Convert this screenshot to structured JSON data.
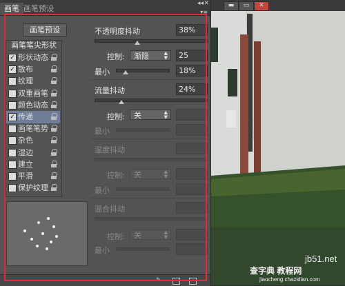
{
  "tabs": {
    "active": "画笔",
    "inactive": "画笔预设"
  },
  "window_controls": {
    "collapse": "◂◂",
    "close": "✕",
    "menu": "▾≡"
  },
  "preset_button": "画笔预设",
  "list_header": "画笔笔尖形状",
  "options": [
    {
      "label": "形状动态",
      "checked": true,
      "selected": false
    },
    {
      "label": "散布",
      "checked": true,
      "selected": false
    },
    {
      "label": "纹理",
      "checked": false,
      "selected": false
    },
    {
      "label": "双重画笔",
      "checked": false,
      "selected": false
    },
    {
      "label": "颜色动态",
      "checked": false,
      "selected": false
    },
    {
      "label": "传递",
      "checked": true,
      "selected": true
    },
    {
      "label": "画笔笔势",
      "checked": false,
      "selected": false
    },
    {
      "label": "杂色",
      "checked": false,
      "selected": false
    },
    {
      "label": "湿边",
      "checked": false,
      "selected": false
    },
    {
      "label": "建立",
      "checked": false,
      "selected": false
    },
    {
      "label": "平滑",
      "checked": false,
      "selected": false
    },
    {
      "label": "保护纹理",
      "checked": false,
      "selected": false
    }
  ],
  "opacity_jitter": {
    "label": "不透明度抖动",
    "value": "38%",
    "level": 0.38
  },
  "opacity_control": {
    "label": "控制:",
    "value": "渐隐",
    "steps": "25"
  },
  "opacity_min": {
    "label": "最小",
    "value": "18%",
    "level": 0.18
  },
  "flow_jitter": {
    "label": "流量抖动",
    "value": "24%",
    "level": 0.24
  },
  "flow_control": {
    "label": "控制:",
    "value": "关"
  },
  "flow_min": {
    "label": "最小"
  },
  "wetness_jitter": {
    "label": "湿度抖动"
  },
  "wetness_control": {
    "label": "控制:",
    "value": "关"
  },
  "wetness_min": {
    "label": "最小"
  },
  "mix_jitter": {
    "label": "混合抖动"
  },
  "mix_control": {
    "label": "控制:",
    "value": "关"
  },
  "mix_min": {
    "label": "最小"
  },
  "photo_window": {
    "minimize": "▬",
    "restore": "▭",
    "close": "✕"
  },
  "watermark": {
    "site": "jb51.net",
    "text": "查字典 教程网",
    "url": "jiaocheng.chazidian.com"
  },
  "colors": {
    "accent": "#e8283a",
    "panel": "#535353",
    "selection": "#6f7e96"
  }
}
